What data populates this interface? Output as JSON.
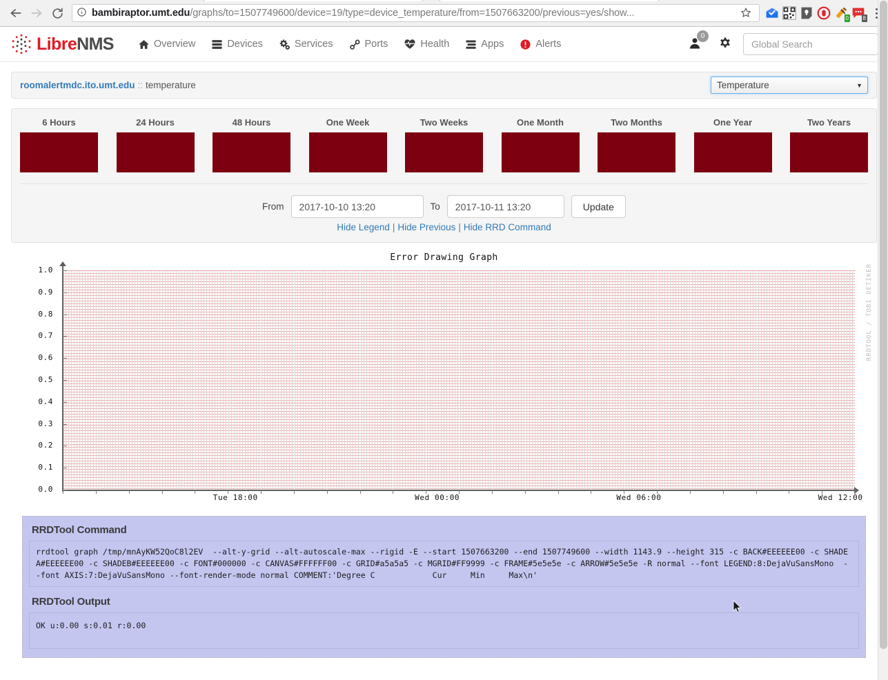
{
  "browser": {
    "back_icon": "back-arrow-icon",
    "forward_icon": "forward-arrow-icon",
    "reload_icon": "reload-icon",
    "info_icon": "info-circle-icon",
    "url_host": "bambiraptor.umt.edu",
    "url_path": "/graphs/to=1507749600/device=19/type=device_temperature/from=1507663200/previous=yes/show...",
    "star_icon": "bookmark-star-icon",
    "extensions": [
      {
        "name": "inbox-extension-icon",
        "badge": null
      },
      {
        "name": "qr-code-extension-icon",
        "badge": null
      },
      {
        "name": "note-extension-icon",
        "badge": null
      },
      {
        "name": "ublock-origin-extension-icon",
        "badge": null
      },
      {
        "name": "honey-extension-icon",
        "badge": "0"
      },
      {
        "name": "messages-extension-icon",
        "badge": "8"
      }
    ],
    "menu_icon": "three-dot-menu-icon"
  },
  "navbar": {
    "brand_libre": "Libre",
    "brand_nms": "NMS",
    "items": [
      {
        "label": "Overview",
        "icon": "home-icon"
      },
      {
        "label": "Devices",
        "icon": "server-stack-icon"
      },
      {
        "label": "Services",
        "icon": "gears-icon"
      },
      {
        "label": "Ports",
        "icon": "link-chain-icon"
      },
      {
        "label": "Health",
        "icon": "heartbeat-icon"
      },
      {
        "label": "Apps",
        "icon": "app-stack-icon"
      },
      {
        "label": "Alerts",
        "icon": "alert-exclamation-icon"
      }
    ],
    "user_icon": "user-icon",
    "user_badge": "0",
    "settings_icon": "gear-icon",
    "search_placeholder": "Global Search",
    "search_value": ""
  },
  "breadcrumb": {
    "host": "roomalertmdc.ito.umt.edu",
    "separator": "::",
    "leaf": "temperature",
    "type_selected": "Temperature",
    "caret_icon": "chevron-down-icon"
  },
  "chooser": {
    "thumbs": [
      {
        "label": "6 Hours"
      },
      {
        "label": "24 Hours"
      },
      {
        "label": "48 Hours"
      },
      {
        "label": "One Week"
      },
      {
        "label": "Two Weeks"
      },
      {
        "label": "One Month"
      },
      {
        "label": "Two Months"
      },
      {
        "label": "One Year"
      },
      {
        "label": "Two Years"
      }
    ],
    "thumb_color": "#7d0011"
  },
  "range_form": {
    "from_label": "From",
    "from_value": "2017-10-10 13:20",
    "to_label": "To",
    "to_value": "2017-10-11 13:20",
    "update_label": "Update",
    "placeholder": ""
  },
  "toggle_links": {
    "legend": "Hide Legend",
    "previous": "Hide Previous",
    "rrd": "Hide RRD Command",
    "pipe": "|"
  },
  "graph": {
    "title": "Error Drawing Graph",
    "watermark": "RRDTOOL / TOBI OETIKER",
    "cursor_icon": "mouse-cursor-icon"
  },
  "chart_data": {
    "type": "line",
    "title": "Error Drawing Graph",
    "xlabel": "",
    "ylabel": "",
    "series": [],
    "x_ticks": [
      "Tue 18:00",
      "Wed 00:00",
      "Wed 06:00",
      "Wed 12:00"
    ],
    "x_tick_positions": [
      0.218,
      0.4727,
      0.7273,
      0.9818
    ],
    "y_ticks": [
      "0.0",
      "0.1",
      "0.2",
      "0.3",
      "0.4",
      "0.5",
      "0.6",
      "0.7",
      "0.8",
      "0.9",
      "1.0"
    ],
    "ylim": [
      0,
      1
    ],
    "grid": true,
    "legend": "none",
    "note": "Graph failed to render; empty plot area with axes only"
  },
  "rrdtool": {
    "command_heading": "RRDTool Command",
    "command": "rrdtool graph /tmp/mnAyKW52QoC8l2EV  --alt-y-grid --alt-autoscale-max --rigid -E --start 1507663200 --end 1507749600 --width 1143.9 --height 315 -c BACK#EEEEEE00 -c SHADEA#EEEEEE00 -c SHADEB#EEEEEE00 -c FONT#000000 -c CANVAS#FFFFFF00 -c GRID#a5a5a5 -c MGRID#FF9999 -c FRAME#5e5e5e -c ARROW#5e5e5e -R normal --font LEGEND:8:DejaVuSansMono  --font AXIS:7:DejaVuSansMono --font-render-mode normal COMMENT:'Degree C            Cur     Min     Max\\n'",
    "output_heading": "RRDTool Output",
    "output": "OK u:0.00 s:0.01 r:0.00"
  }
}
